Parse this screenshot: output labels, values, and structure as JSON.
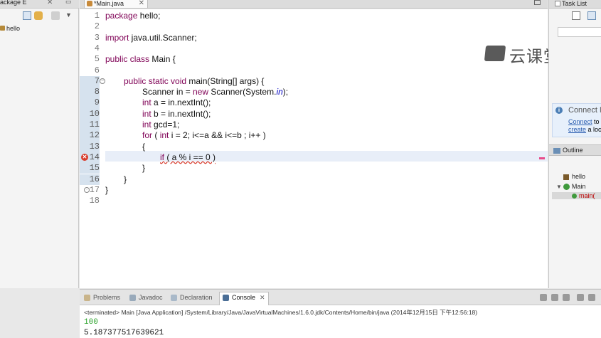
{
  "package_explorer": {
    "tab_label": "Package E",
    "tree_items": [
      "hello"
    ]
  },
  "editor": {
    "tab_label": "*Main.java",
    "line_numbers": [
      "1",
      "2",
      "3",
      "4",
      "5",
      "6",
      "7",
      "8",
      "9",
      "10",
      "11",
      "12",
      "13",
      "14",
      "15",
      "16",
      "17",
      "18"
    ],
    "lines": {
      "l1": {
        "kw": "package",
        "rest": " hello;"
      },
      "l3": {
        "kw": "import",
        "rest": " java.util.Scanner;"
      },
      "l5": {
        "kw": "public class",
        "rest": " Main {"
      },
      "l7": {
        "kw": "public static void",
        "rest": " main(String[] args) {"
      },
      "l8": {
        "a": "Scanner in = ",
        "kw": "new",
        "b": " Scanner(System.",
        "fld": "in",
        "c": ");"
      },
      "l9": {
        "kw": "int",
        "rest": " a = in.nextInt();"
      },
      "l10": {
        "kw": "int",
        "rest": " b = in.nextInt();"
      },
      "l11": {
        "kw": "int",
        "rest": " gcd=1;"
      },
      "l12": {
        "kw": "for",
        "a": " ( ",
        "kw2": "int",
        "b": " i = 2; i<=a && i<=b ; i++ )"
      },
      "l13": {
        "text": "{"
      },
      "l14": {
        "kw": "if",
        "rest": " ( a % i == 0 )"
      },
      "l15": {
        "text": "}"
      },
      "l16": {
        "text": "}"
      },
      "l17": {
        "text": "}"
      }
    }
  },
  "watermark": {
    "text": "云课堂"
  },
  "task_list": {
    "tab_label": "Task List"
  },
  "connect": {
    "title": "Connect M",
    "line1_link": "Connect",
    "line1_rest": " to",
    "line2_link": "create",
    "line2_rest": " a loc"
  },
  "outline": {
    "tab_label": "Outline",
    "items": [
      "hello",
      "Main",
      "main("
    ]
  },
  "console": {
    "tabs": [
      "Problems",
      "Javadoc",
      "Declaration",
      "Console"
    ],
    "terminated_line": "<terminated> Main [Java Application] /System/Library/Java/JavaVirtualMachines/1.6.0.jdk/Contents/Home/bin/java (2014年12月15日 下午12:56:18)",
    "input_line": "100",
    "output_line": "5.187377517639621"
  },
  "colors": {
    "keyword": "#7f0055",
    "field": "#0000c0",
    "input_text": "#2aa22a",
    "error": "#d83b2b"
  }
}
